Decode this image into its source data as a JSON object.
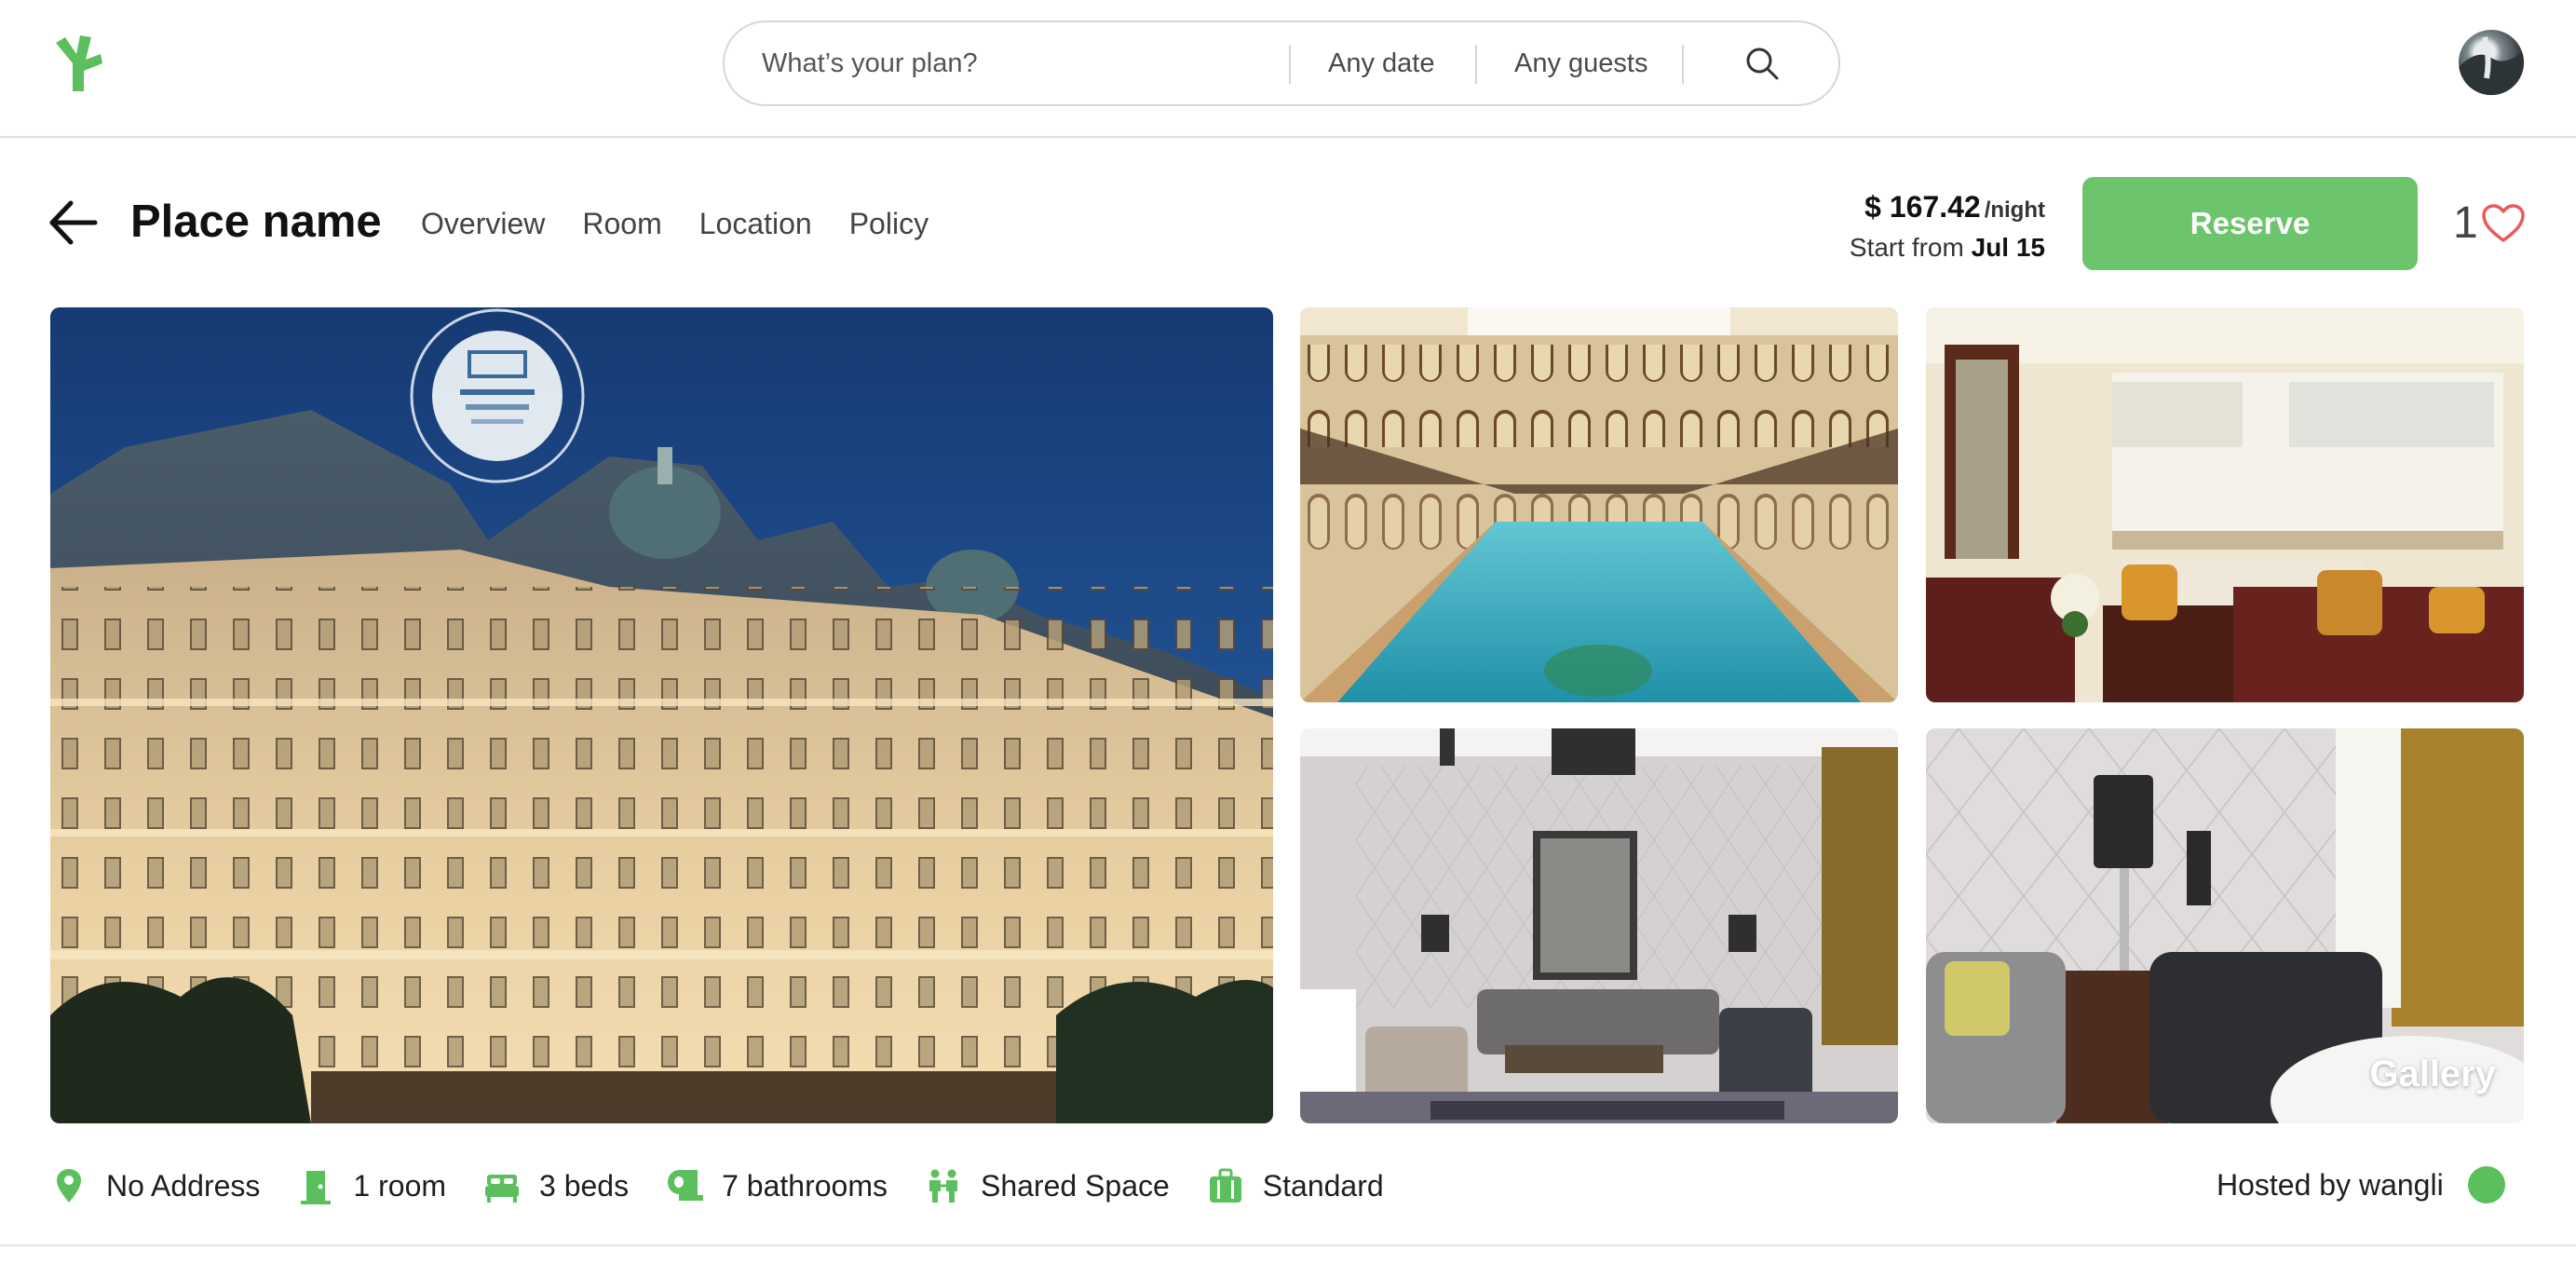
{
  "colors": {
    "brand": "#5bbf5d",
    "reserve": "#6cc56d",
    "heart": "#e85a5a",
    "border": "#d6d6d6"
  },
  "topbar": {
    "logo_icon": "leaf-sprout-icon",
    "search": {
      "plan_placeholder": "What’s your plan?",
      "date": "Any date",
      "guests": "Any guests",
      "icon": "search-icon"
    },
    "avatar": "user-avatar"
  },
  "header": {
    "back_icon": "arrow-left-icon",
    "place_name": "Place name",
    "tabs": [
      {
        "label": "Overview"
      },
      {
        "label": "Room"
      },
      {
        "label": "Location"
      },
      {
        "label": "Policy"
      }
    ],
    "price": "$ 167.42",
    "price_unit": "/night",
    "start_prefix": "Start from",
    "start_date": "Jul 15",
    "reserve_label": "Reserve",
    "favorite_count": "1",
    "favorite_icon": "heart-icon"
  },
  "gallery": {
    "label": "Gallery",
    "photos": [
      {
        "subject": "hotel-exterior-night"
      },
      {
        "subject": "indoor-pool"
      },
      {
        "subject": "kitchen-living-room"
      },
      {
        "subject": "living-room"
      },
      {
        "subject": "lamp-and-chair"
      }
    ]
  },
  "amenities": [
    {
      "icon": "location-pin-icon",
      "label": "No Address"
    },
    {
      "icon": "door-icon",
      "label": "1 room"
    },
    {
      "icon": "bed-icon",
      "label": "3 beds"
    },
    {
      "icon": "toilet-paper-icon",
      "label": "7 bathrooms"
    },
    {
      "icon": "people-icon",
      "label": "Shared Space"
    },
    {
      "icon": "briefcase-icon",
      "label": "Standard"
    }
  ],
  "host": {
    "label": "Hosted by wangli"
  }
}
